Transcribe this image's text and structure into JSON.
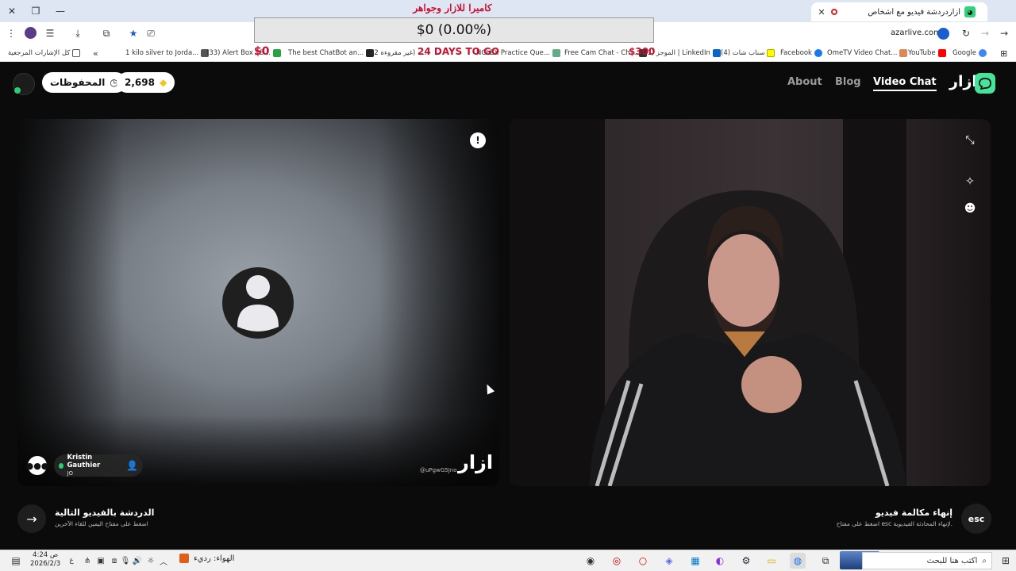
{
  "browser": {
    "tab_title": "أزاردردشة فيديو مع أشخاص",
    "url": "azarlive.com",
    "all_bookmarks": "كل الإشارات المرجعية",
    "bookmarks": [
      "1 kilo silver to Jorda...",
      "(33) Alert Box / S...",
      "The best ChatBot an...",
      "22 غير مقروءة) -...",
      "NCLEX Practice Que...",
      "Free Cam Chat - Ch...",
      "(1) الموجز | LinkedIn",
      "(4) سناب شات",
      "Facebook",
      "OmeTV Video Chat...",
      "YouTube",
      "Google"
    ]
  },
  "promo": {
    "title": "كاميرا للازار وجواهر",
    "progress": "$0 (0.00%)",
    "progress_fraction": 0,
    "left_amount": "$0",
    "days": "24 DAYS TO GO",
    "right_amount": "$300"
  },
  "header": {
    "nav_about": "About",
    "nav_blog": "Blog",
    "nav_video": "Video Chat",
    "logo": "ازار",
    "gems": "2,698",
    "saved": "المحفوظات"
  },
  "left_video": {
    "peer_name": "Kristin Gauthier",
    "peer_country": "JO",
    "watermark_logo": "ازار",
    "watermark_id": "@uPgwG5Jno"
  },
  "actions": {
    "next_title": "الدردشة بالفيديو التالية",
    "next_sub": "اضغط على مفتاح اليمين للقاء الآخرين",
    "esc_label": "esc",
    "end_title": "إنهاء مكالمة فيديو",
    "end_sub": "اضغط على مفتاح esc لإنهاء المحادثة الفيديوية."
  },
  "taskbar": {
    "search_placeholder": "اكتب هنا للبحث",
    "time": "4:24 ص",
    "date": "2026/2/3",
    "lang": "ع",
    "weather": "الهواء: رديء"
  },
  "colors": {
    "brand_green": "#48e39a",
    "promo_red": "#c8102e",
    "page_bg": "#0b0b0b"
  }
}
